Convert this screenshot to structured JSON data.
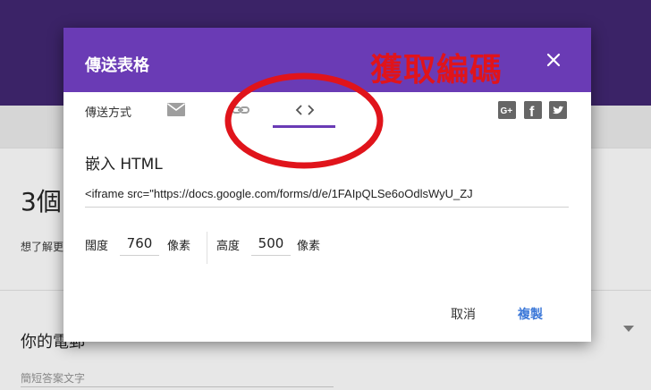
{
  "background": {
    "form_title": "3個",
    "form_desc": "想了解更",
    "question_title": "你的電郵",
    "answer_placeholder": "簡短答案文字"
  },
  "dialog": {
    "title": "傳送表格",
    "close_icon": "close-icon",
    "tabs": {
      "label": "傳送方式",
      "items": [
        "mail-icon",
        "link-icon",
        "embed-code-icon"
      ],
      "active": "embed-code-icon"
    },
    "social": [
      "google-plus-icon",
      "facebook-icon",
      "twitter-icon"
    ],
    "embed": {
      "heading": "嵌入 HTML",
      "code": "<iframe src=\"https://docs.google.com/forms/d/e/1FAIpQLSe6oOdlsWyU_ZJ"
    },
    "width": {
      "label": "闊度",
      "value": "760",
      "unit": "像素"
    },
    "height": {
      "label": "高度",
      "value": "500",
      "unit": "像素"
    },
    "buttons": {
      "cancel": "取消",
      "copy": "複製"
    }
  },
  "annotation": {
    "text": "獲取編碼",
    "color": "#e0141b"
  },
  "colors": {
    "header_purple": "#6a3bb5",
    "page_header": "#3b2367",
    "link_blue": "#3c78d8"
  }
}
